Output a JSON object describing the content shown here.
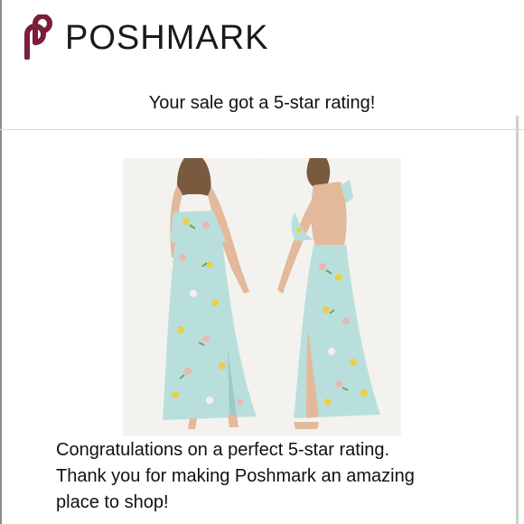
{
  "brand": {
    "name": "POSHMARK",
    "color": "#7b1e3a"
  },
  "email": {
    "subject_line": "Your sale got a 5-star rating!",
    "message_lines": [
      "Congratulations on a perfect 5-star rating.",
      "Thank you for making Poshmark an amazing",
      "place to shop!"
    ]
  },
  "product": {
    "image_description": "mint floral maxi dress, front and back views",
    "dress_color": "#b9dfdc",
    "flower_colors": [
      "#e8d04a",
      "#e9b8b4",
      "#f4f0f0",
      "#7aa15b"
    ]
  }
}
